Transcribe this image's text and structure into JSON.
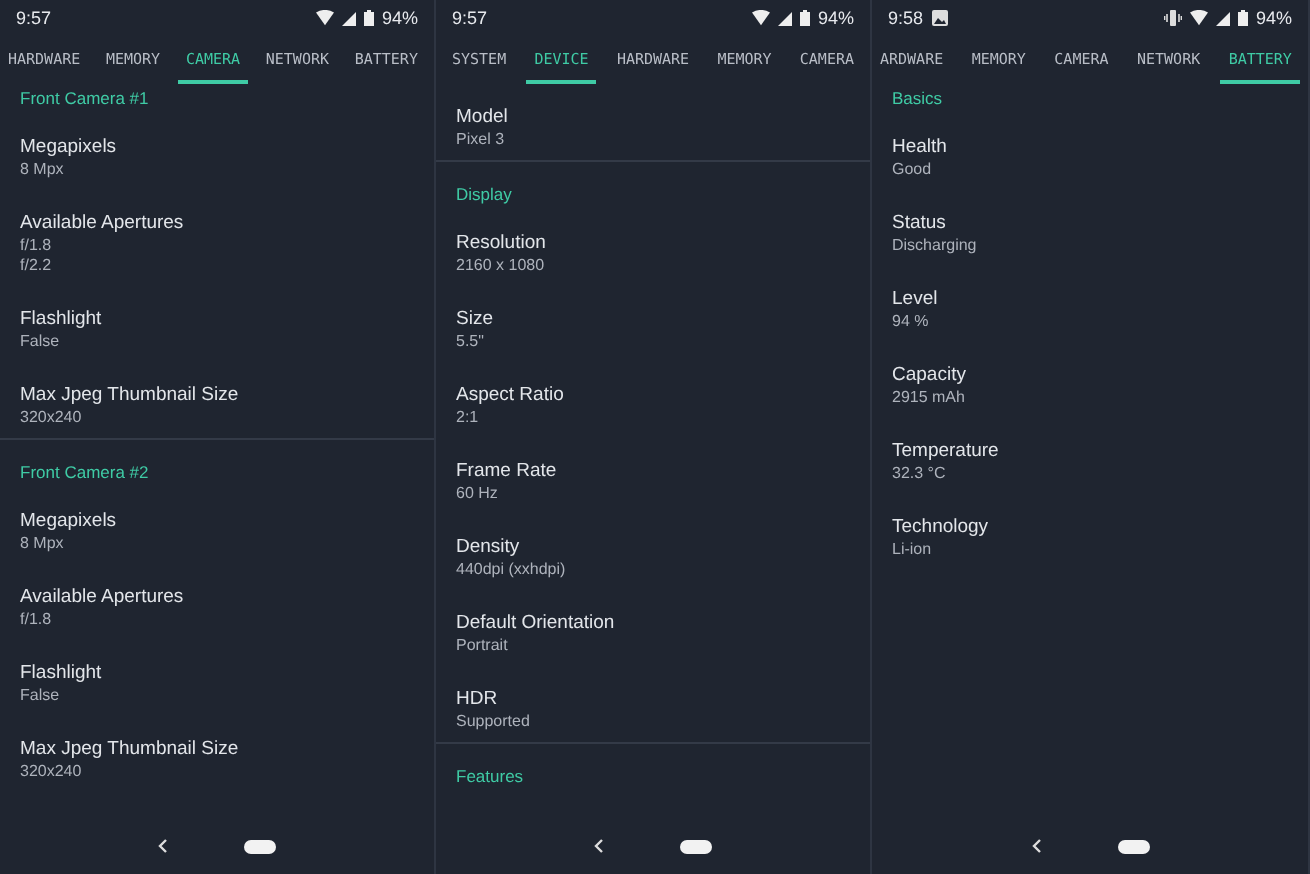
{
  "screens": [
    {
      "status": {
        "time": "9:57",
        "image_notification": false,
        "vibrate": false,
        "battery": "94%"
      },
      "tabs": [
        {
          "label": "HARDWARE",
          "selected": false
        },
        {
          "label": "MEMORY",
          "selected": false
        },
        {
          "label": "CAMERA",
          "selected": true
        },
        {
          "label": "NETWORK",
          "selected": false
        },
        {
          "label": "BATTERY",
          "selected": false
        }
      ],
      "content": [
        {
          "kind": "header",
          "text": "Front Camera #1"
        },
        {
          "kind": "property",
          "label": "Megapixels",
          "values": [
            "8 Mpx"
          ]
        },
        {
          "kind": "property",
          "label": "Available Apertures",
          "values": [
            "f/1.8",
            "f/2.2"
          ]
        },
        {
          "kind": "property",
          "label": "Flashlight",
          "values": [
            "False"
          ]
        },
        {
          "kind": "property",
          "label": "Max Jpeg Thumbnail Size",
          "values": [
            "320x240"
          ]
        },
        {
          "kind": "header",
          "text": "Front Camera #2"
        },
        {
          "kind": "property",
          "label": "Megapixels",
          "values": [
            "8 Mpx"
          ]
        },
        {
          "kind": "property",
          "label": "Available Apertures",
          "values": [
            "f/1.8"
          ]
        },
        {
          "kind": "property",
          "label": "Flashlight",
          "values": [
            "False"
          ]
        },
        {
          "kind": "property",
          "label": "Max Jpeg Thumbnail Size",
          "values": [
            "320x240"
          ]
        }
      ]
    },
    {
      "status": {
        "time": "9:57",
        "image_notification": false,
        "vibrate": false,
        "battery": "94%"
      },
      "tabs": [
        {
          "label": "SYSTEM",
          "selected": false
        },
        {
          "label": "DEVICE",
          "selected": true
        },
        {
          "label": "HARDWARE",
          "selected": false
        },
        {
          "label": "MEMORY",
          "selected": false
        },
        {
          "label": "CAMERA",
          "selected": false
        }
      ],
      "content": [
        {
          "kind": "property",
          "label": "Model",
          "values": [
            "Pixel 3"
          ]
        },
        {
          "kind": "header",
          "text": "Display"
        },
        {
          "kind": "property",
          "label": "Resolution",
          "values": [
            "2160 x 1080"
          ]
        },
        {
          "kind": "property",
          "label": "Size",
          "values": [
            "5.5\""
          ]
        },
        {
          "kind": "property",
          "label": "Aspect Ratio",
          "values": [
            "2:1"
          ]
        },
        {
          "kind": "property",
          "label": "Frame Rate",
          "values": [
            "60 Hz"
          ]
        },
        {
          "kind": "property",
          "label": "Density",
          "values": [
            "440dpi (xxhdpi)"
          ]
        },
        {
          "kind": "property",
          "label": "Default Orientation",
          "values": [
            "Portrait"
          ]
        },
        {
          "kind": "property",
          "label": "HDR",
          "values": [
            "Supported"
          ]
        },
        {
          "kind": "header",
          "text": "Features"
        }
      ]
    },
    {
      "status": {
        "time": "9:58",
        "image_notification": true,
        "vibrate": true,
        "battery": "94%"
      },
      "tabs": [
        {
          "label": "ARDWARE",
          "selected": false
        },
        {
          "label": "MEMORY",
          "selected": false
        },
        {
          "label": "CAMERA",
          "selected": false
        },
        {
          "label": "NETWORK",
          "selected": false
        },
        {
          "label": "BATTERY",
          "selected": true
        }
      ],
      "content": [
        {
          "kind": "header",
          "text": "Basics"
        },
        {
          "kind": "property",
          "label": "Health",
          "values": [
            "Good"
          ]
        },
        {
          "kind": "property",
          "label": "Status",
          "values": [
            "Discharging"
          ]
        },
        {
          "kind": "property",
          "label": "Level",
          "values": [
            "94 %"
          ]
        },
        {
          "kind": "property",
          "label": "Capacity",
          "values": [
            "2915 mAh"
          ]
        },
        {
          "kind": "property",
          "label": "Temperature",
          "values": [
            "32.3 °C"
          ]
        },
        {
          "kind": "property",
          "label": "Technology",
          "values": [
            "Li-ion"
          ]
        }
      ]
    }
  ]
}
